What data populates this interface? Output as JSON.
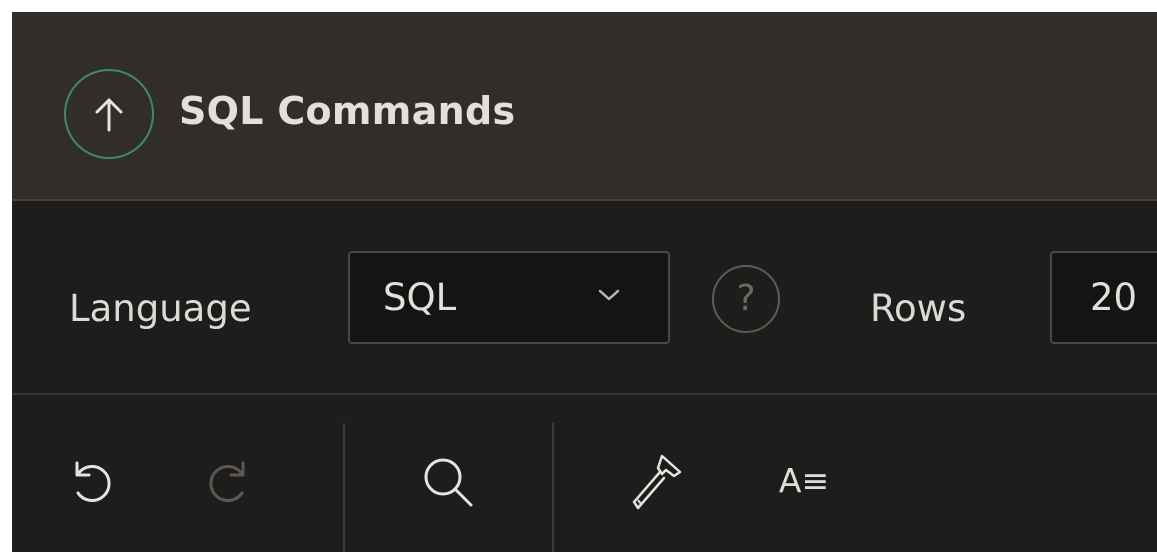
{
  "header": {
    "title": "SQL Commands"
  },
  "settings": {
    "language_label": "Language",
    "language_value": "SQL",
    "rows_label": "Rows",
    "rows_value": "20",
    "help_glyph": "?"
  },
  "toolbar": {
    "format_label": "A≡"
  },
  "icons": [
    "up-arrow-icon",
    "chevron-down-icon",
    "help-icon",
    "undo-icon",
    "redo-icon",
    "search-icon",
    "hammer-icon",
    "format-icon"
  ],
  "colors": {
    "accent": "#3d8b5f",
    "header_bg": "#312d2a",
    "panel_bg": "#1f1d1b",
    "input_bg": "#161412",
    "text": "#e2e0dd"
  }
}
